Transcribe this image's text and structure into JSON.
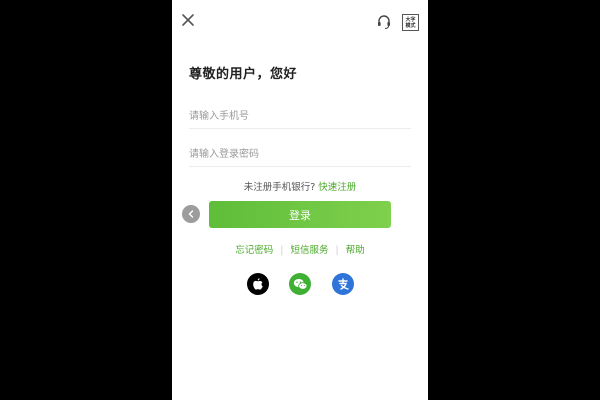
{
  "header": {
    "close_icon": "close-icon",
    "service_icon": "headset-icon",
    "zoom_label_line1": "大字",
    "zoom_label_line2": "模式"
  },
  "login": {
    "greeting": "尊敬的用户，您好",
    "phone_placeholder": "请输入手机号",
    "password_placeholder": "请输入登录密码",
    "register_prompt": "未注册手机银行? ",
    "register_link": "快速注册",
    "login_button": "登录",
    "back_icon": "chevron-left-icon"
  },
  "links": {
    "forgot_password": "忘记密码",
    "sms_service": "短信服务",
    "help": "帮助"
  },
  "social": [
    {
      "name": "apple",
      "icon": "apple-icon",
      "color": "#000000"
    },
    {
      "name": "wechat",
      "icon": "wechat-icon",
      "color": "#3fb033"
    },
    {
      "name": "alipay",
      "icon": "alipay-icon",
      "color": "#2f74d8"
    }
  ],
  "colors": {
    "accent": "#4caa2c",
    "button_start": "#5ebd3a",
    "button_end": "#7fd04c"
  }
}
